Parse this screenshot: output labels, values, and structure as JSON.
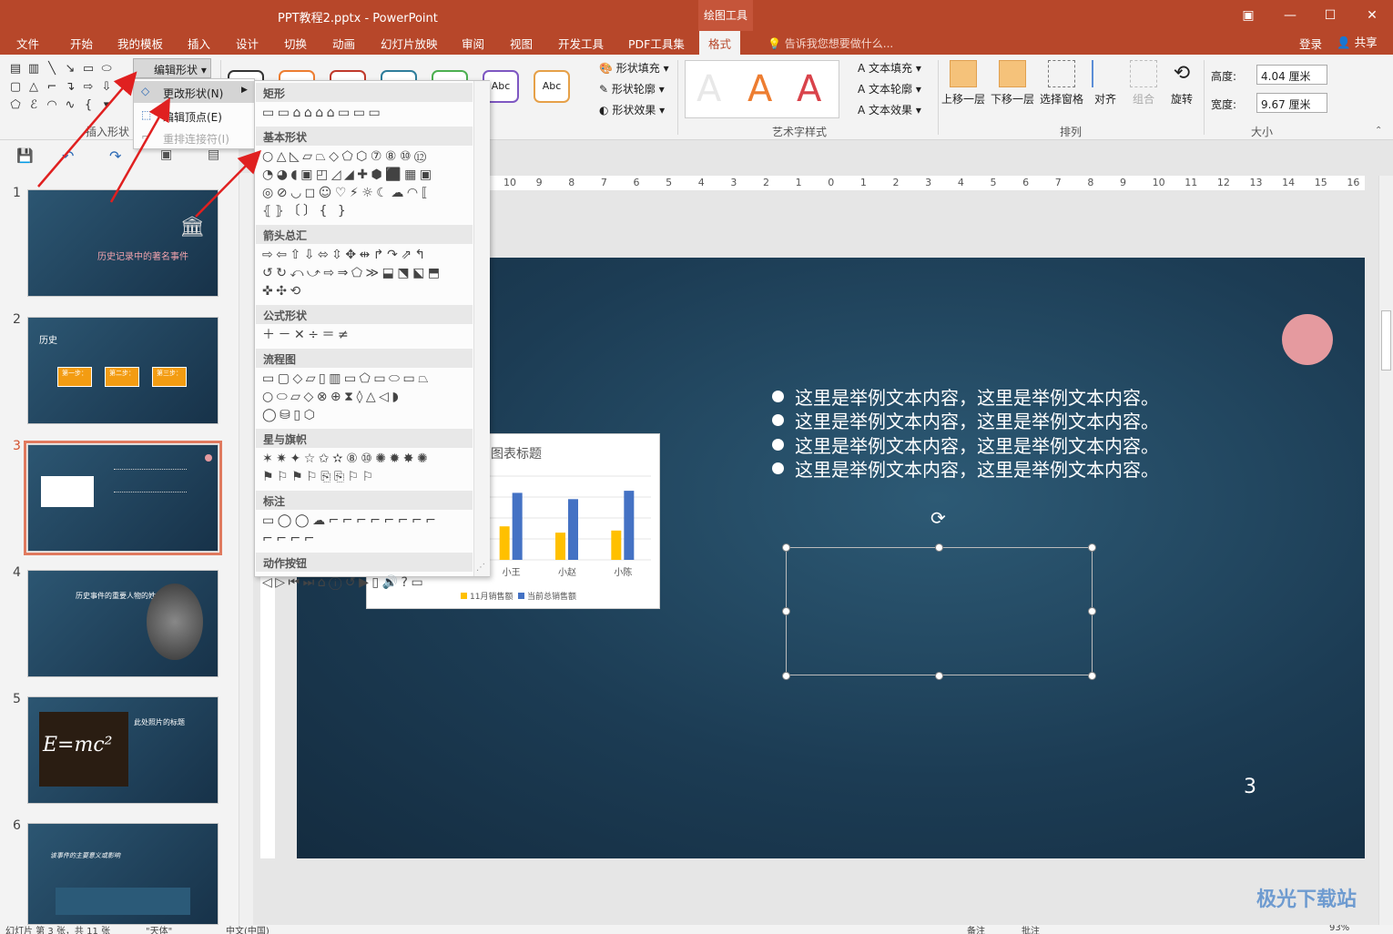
{
  "app": {
    "window_title": "PPT教程2.pptx - PowerPoint",
    "context_tab_group": "绘图工具"
  },
  "menu_tabs": [
    "文件",
    "开始",
    "我的模板",
    "插入",
    "设计",
    "切换",
    "动画",
    "幻灯片放映",
    "审阅",
    "视图",
    "开发工具",
    "PDF工具集",
    "格式"
  ],
  "active_tab": "格式",
  "tell_me": "告诉我您想要做什么...",
  "account": {
    "login": "登录",
    "share": "共享"
  },
  "ribbon": {
    "insert_shapes": {
      "label": "插入形状",
      "edit_shape": "编辑形状"
    },
    "shape_styles": {
      "preset_label": "Abc",
      "fill": "形状填充",
      "outline": "形状轮廓",
      "effect": "形状效果"
    },
    "wordart": {
      "label": "艺术字样式",
      "preset": "A",
      "text_fill": "文本填充",
      "text_outline": "文本轮廓",
      "text_effect": "文本效果"
    },
    "arrange": {
      "label": "排列",
      "bring_forward": "上移一层",
      "send_backward": "下移一层",
      "selection_pane": "选择窗格",
      "align": "对齐",
      "group": "组合",
      "rotate": "旋转"
    },
    "size": {
      "label": "大小",
      "height_label": "高度:",
      "height_value": "4.04 厘米",
      "width_label": "宽度:",
      "width_value": "9.67 厘米"
    }
  },
  "edit_shape_menu": {
    "change_shape": "更改形状(N)",
    "edit_points": "编辑顶点(E)",
    "reroute": "重排连接符(I)"
  },
  "shape_gallery": {
    "categories": [
      {
        "name": "矩形",
        "rows": [
          "▭▭⌂⌂⌂⌂▭▭▭"
        ]
      },
      {
        "name": "基本形状",
        "rows": [
          "○△◺▱⏢◇⬠⬡⑦⑧⑩⑫",
          "◔◕◖▣◰◿◢✚⬢⬛▦▣",
          "◎⊘◡◻☺♡⚡☼☾☁◠⟦",
          "⦃⦄〔〕{ }"
        ]
      },
      {
        "name": "箭头总汇",
        "rows": [
          "⇨⇦⇧⇩⬄⇳✥⇹↱↷⇗↰",
          "↺↻⤺⤻⇨⇒⬠≫⬓⬔⬕⬒",
          "✜✣⟲"
        ]
      },
      {
        "name": "公式形状",
        "rows": [
          "＋－✕÷＝≠"
        ]
      },
      {
        "name": "流程图",
        "rows": [
          "▭▢◇▱▯▥▭⬠▭⬭▭⏢",
          "○⬭▱◇⊗⊕⧗◊△◁◗",
          "◯⛁▯⬡"
        ]
      },
      {
        "name": "星与旗帜",
        "rows": [
          "✶✷✦☆✩✫⑧⑩✺✹✸✺",
          "⚑⚐⚑⚐⎘⎘⚐⚐"
        ]
      },
      {
        "name": "标注",
        "rows": [
          "▭◯◯☁⌐⌐⌐⌐⌐⌐⌐⌐",
          "⌐⌐⌐⌐"
        ]
      },
      {
        "name": "动作按钮",
        "rows": [
          "◁▷⏮⏭⌂ⓘ↺▶▯🔊?▭"
        ]
      }
    ]
  },
  "thumbnails": [
    {
      "num": "1",
      "title": "历史记录中的著名事件"
    },
    {
      "num": "2",
      "title": "历史",
      "steps": [
        "第一步：",
        "第二步：",
        "第三步："
      ]
    },
    {
      "num": "3",
      "title": ""
    },
    {
      "num": "4",
      "title": "历史事件的重要人物的姓名"
    },
    {
      "num": "5",
      "title": "此处照片的标题",
      "formula": "E=mc²"
    },
    {
      "num": "6",
      "title": "该事件的主要意义或影响"
    }
  ],
  "selected_slide": 3,
  "slide": {
    "bullets": [
      "这里是举例文本内容，这里是举例文本内容。",
      "这里是举例文本内容，这里是举例文本内容。",
      "这里是举例文本内容，这里是举例文本内容。",
      "这里是举例文本内容，这里是举例文本内容。"
    ],
    "page_number": "3"
  },
  "ruler_ticks": [
    "10",
    "9",
    "8",
    "7",
    "6",
    "5",
    "4",
    "3",
    "2",
    "1",
    "0",
    "1",
    "2",
    "3",
    "4",
    "5",
    "6",
    "7",
    "8",
    "9",
    "10",
    "11",
    "12",
    "13",
    "14",
    "15",
    "16"
  ],
  "chart_data": {
    "type": "bar",
    "title": "图表标题",
    "categories": [
      "小王",
      "小赵",
      "小陈"
    ],
    "series": [
      {
        "name": "11月销售额",
        "color": "#ffc000",
        "values": [
          1.6,
          1.3,
          1.4
        ]
      },
      {
        "name": "当前总销售额",
        "color": "#4472c4",
        "values": [
          3.2,
          2.9,
          3.3
        ]
      }
    ],
    "ylim": [
      0,
      4
    ],
    "legend_position": "bottom"
  },
  "statusbar": {
    "slide_info": "幻灯片 第 3 张，共 11 张",
    "theme": "\"天体\"",
    "language": "中文(中国)",
    "notes": "备注",
    "comments": "批注",
    "zoom": "93%"
  },
  "watermark": "极光下载站",
  "colors": {
    "brand": "#b7472a",
    "slide_bg": "#1c3c54",
    "accent_circle": "#e59a9f",
    "annotation_arrow": "#e02020"
  }
}
